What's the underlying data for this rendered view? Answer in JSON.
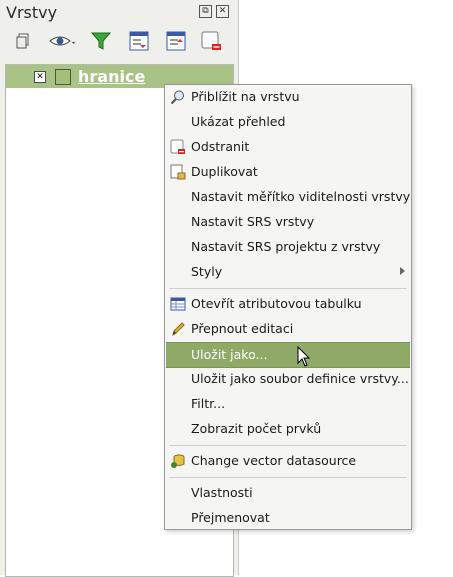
{
  "panel": {
    "title": "Vrstvy",
    "float_glyph": "⧉",
    "close_glyph": "✕",
    "toolbar": [
      "add-group-icon",
      "visibility-eye-icon",
      "filter-funnel-icon",
      "expand-all-icon",
      "collapse-all-icon",
      "remove-layer-icon"
    ]
  },
  "layer": {
    "name": "hranice",
    "checked": true,
    "check_glyph": "✕",
    "swatch_color": "#a3bf7b"
  },
  "menu": {
    "items": [
      {
        "label": "Přiblížit na vrstvu",
        "icon": "zoom-icon"
      },
      {
        "label": "Ukázat přehled",
        "icon": ""
      },
      {
        "label": "Odstranit",
        "icon": "remove-icon"
      },
      {
        "label": "Duplikovat",
        "icon": "duplicate-icon"
      },
      {
        "label": "Nastavit měřítko viditelnosti vrstvy",
        "icon": ""
      },
      {
        "label": "Nastavit SRS vrstvy",
        "icon": ""
      },
      {
        "label": "Nastavit SRS projektu z vrstvy",
        "icon": ""
      },
      {
        "label": "Styly",
        "icon": "",
        "submenu": true
      },
      {
        "label": "Otevřít atributovou tabulku",
        "icon": "table-icon"
      },
      {
        "label": "Přepnout editaci",
        "icon": "pencil-icon"
      },
      {
        "label": "Uložit jako...",
        "icon": "",
        "highlighted": true
      },
      {
        "label": "Uložit jako soubor definice vrstvy...",
        "icon": ""
      },
      {
        "label": "Filtr...",
        "icon": ""
      },
      {
        "label": "Zobrazit počet prvků",
        "icon": ""
      },
      {
        "label": "Change vector datasource",
        "icon": "datasource-icon"
      },
      {
        "label": "Vlastnosti",
        "icon": ""
      },
      {
        "label": "Přejmenovat",
        "icon": ""
      }
    ]
  },
  "colors": {
    "highlight": "#8faa67",
    "layer_row": "#a9c286",
    "menu_bg": "#f5f5f3"
  }
}
